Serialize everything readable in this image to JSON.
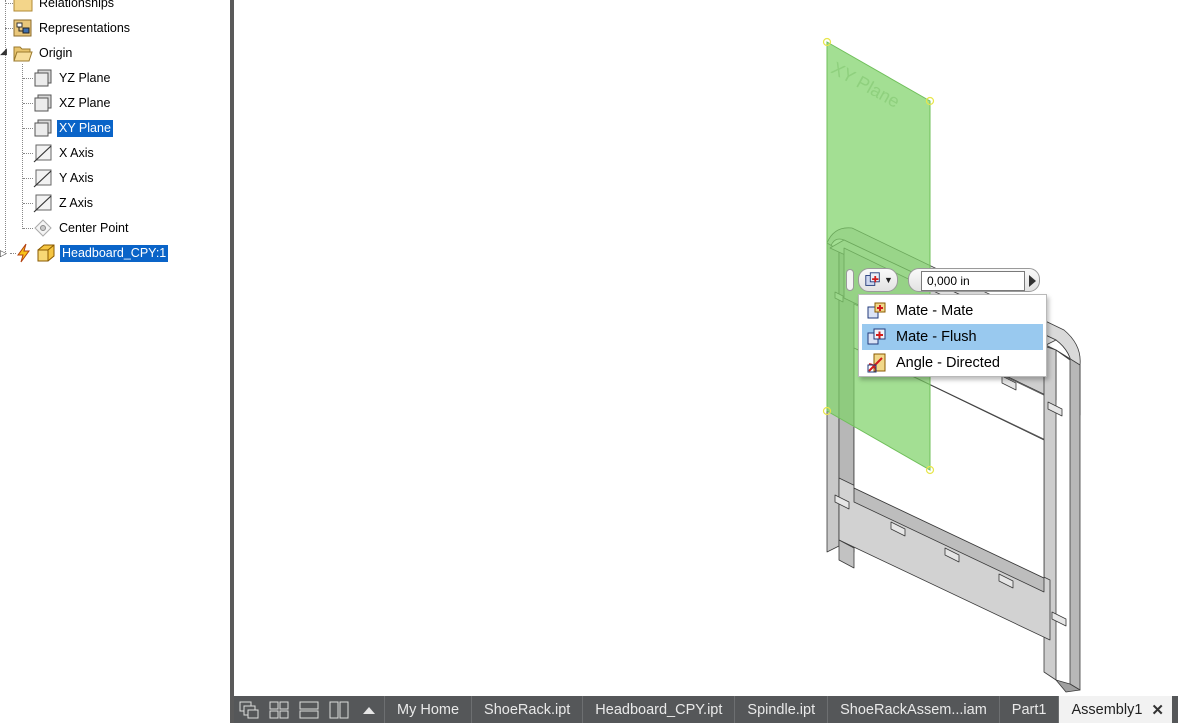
{
  "browser": {
    "items": [
      {
        "label": "Relationships",
        "icon": "folder-icon"
      },
      {
        "label": "Representations",
        "icon": "representations-icon"
      },
      {
        "label": "Origin",
        "icon": "open-folder-icon"
      },
      {
        "label": "YZ Plane",
        "icon": "plane-icon"
      },
      {
        "label": "XZ Plane",
        "icon": "plane-icon"
      },
      {
        "label": "XY Plane",
        "icon": "plane-icon",
        "selected": true
      },
      {
        "label": "X Axis",
        "icon": "axis-icon"
      },
      {
        "label": "Y Axis",
        "icon": "axis-icon"
      },
      {
        "label": "Z Axis",
        "icon": "axis-icon"
      },
      {
        "label": "Center Point",
        "icon": "center-point-icon"
      },
      {
        "label": "Headboard_CPY:1",
        "icon": "part-icon",
        "selected": true
      }
    ]
  },
  "viewport": {
    "plane_label": "XY Plane",
    "plane_color": "#7fd36a"
  },
  "mini_toolbar": {
    "offset_value": "0,000 in"
  },
  "constraint_menu": {
    "items": [
      {
        "label": "Mate - Mate",
        "icon": "mate-mate-icon"
      },
      {
        "label": "Mate - Flush",
        "icon": "mate-flush-icon",
        "highlighted": true
      },
      {
        "label": "Angle - Directed",
        "icon": "angle-directed-icon"
      }
    ]
  },
  "tabs": [
    {
      "label": "My Home"
    },
    {
      "label": "ShoeRack.ipt"
    },
    {
      "label": "Headboard_CPY.ipt"
    },
    {
      "label": "Spindle.ipt"
    },
    {
      "label": "ShoeRackAssem...iam"
    },
    {
      "label": "Part1"
    },
    {
      "label": "Assembly1",
      "active": true
    }
  ],
  "colors": {
    "selection": "#0a64c8",
    "menu_highlight": "#99c9ef",
    "tabbar": "#555759"
  }
}
